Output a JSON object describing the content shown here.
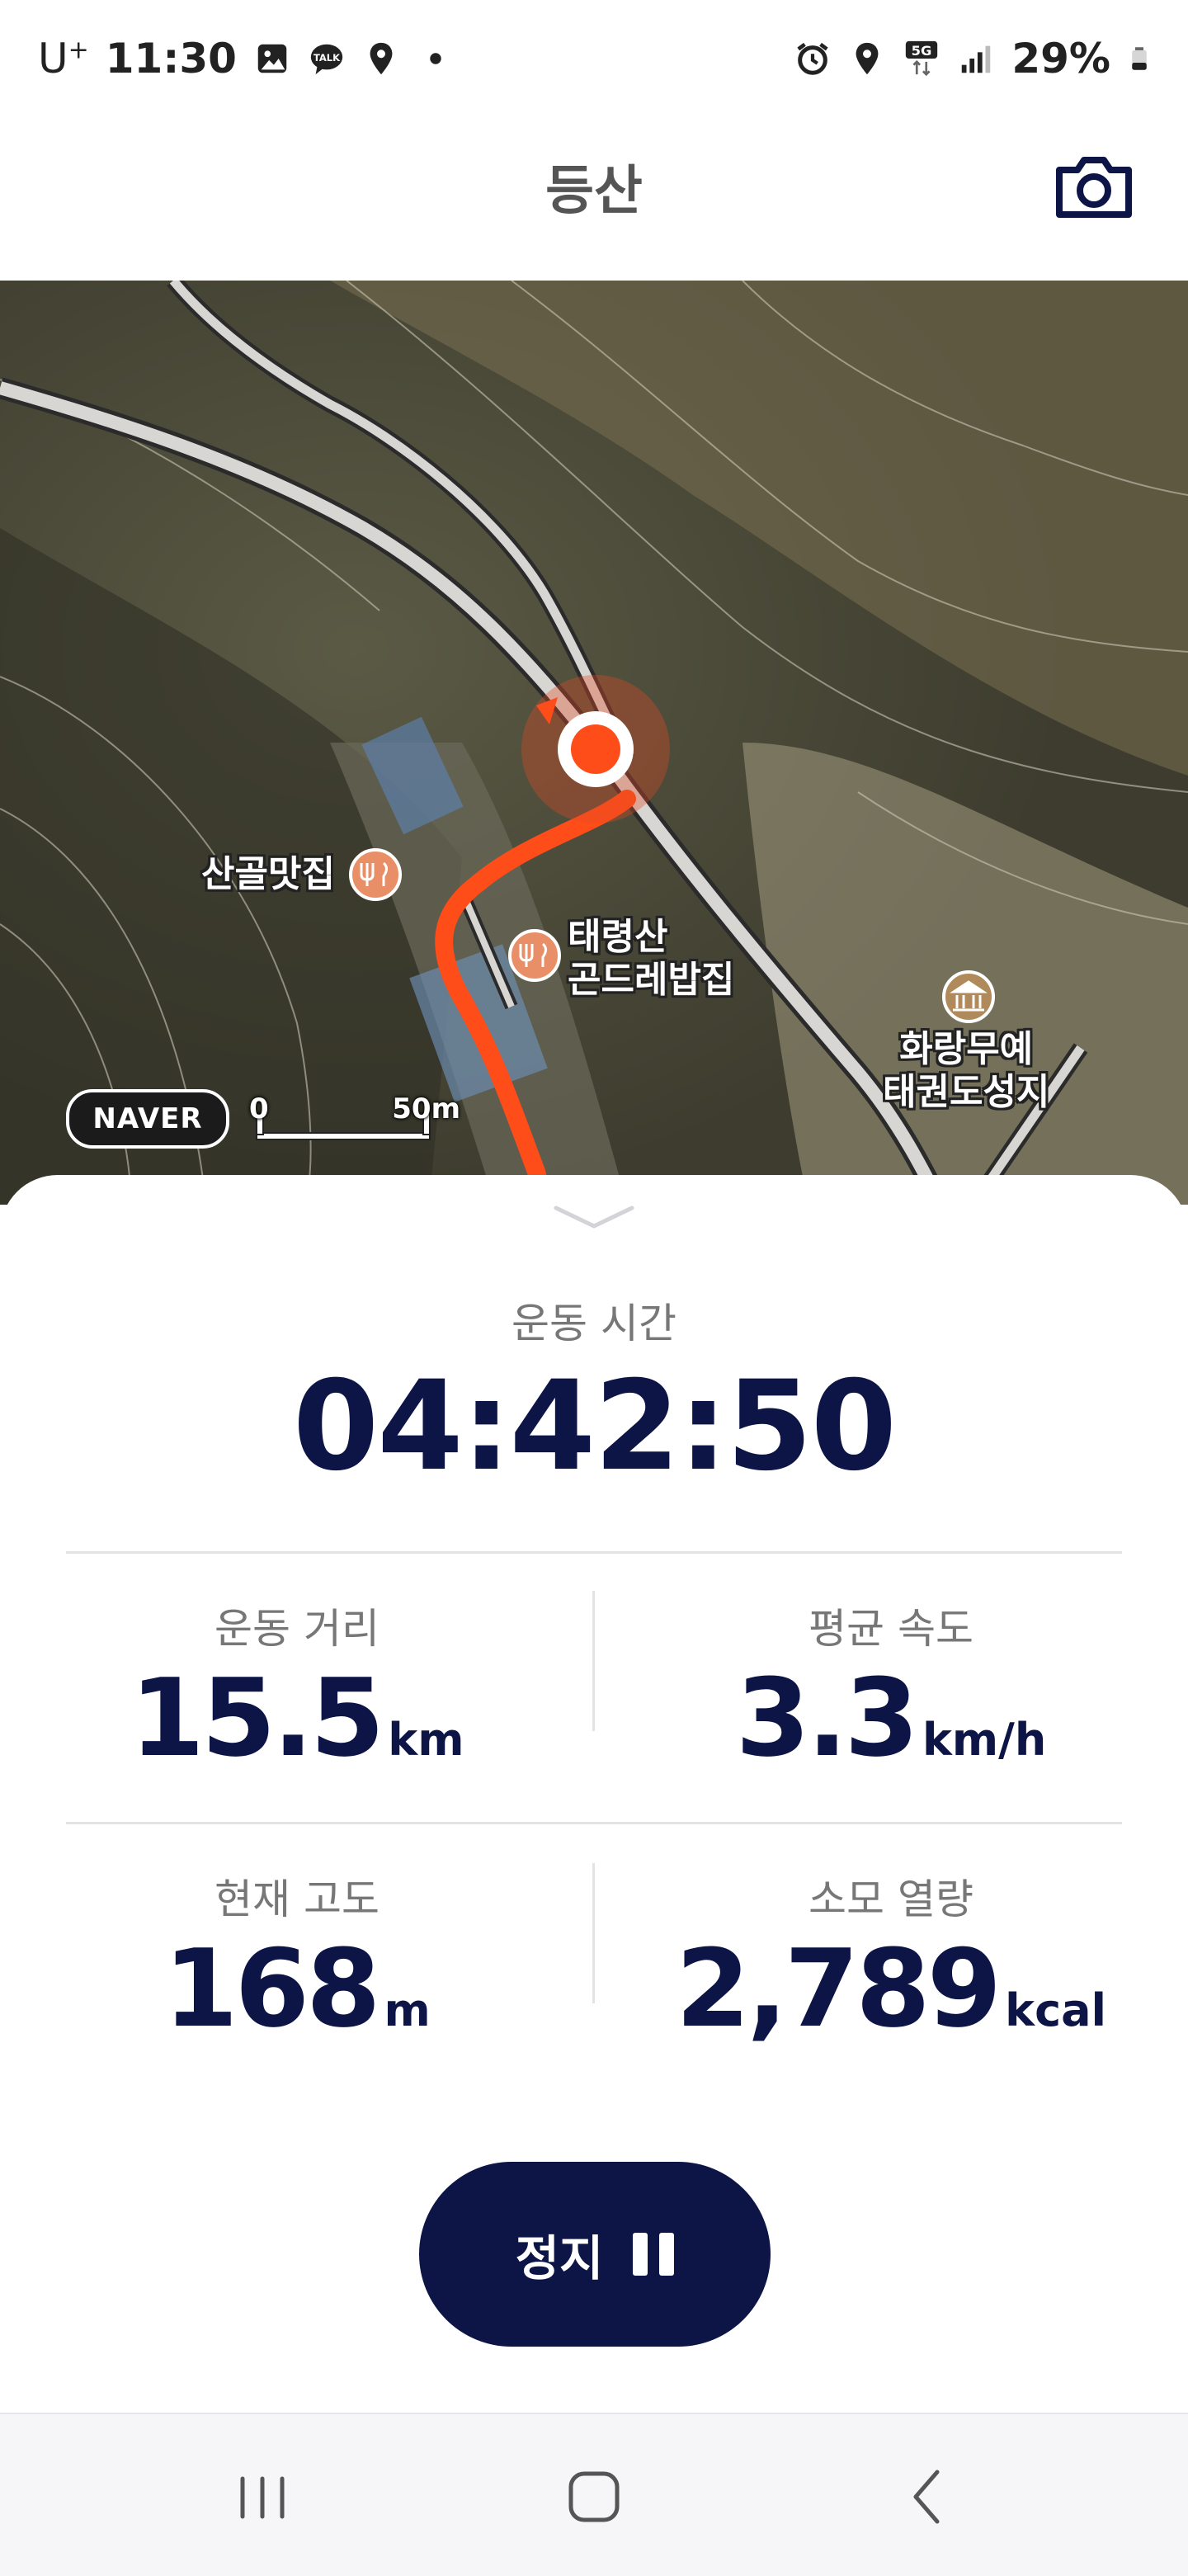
{
  "status_bar": {
    "carrier": "U",
    "carrier_sup": "+",
    "time": "11:30",
    "network": "5G",
    "battery": "29%",
    "left_icons": [
      "gallery-icon",
      "talk-icon",
      "location-icon",
      "dot-icon"
    ],
    "right_icons": [
      "alarm-icon",
      "location-icon",
      "5g-icon",
      "signal-icon",
      "battery-icon"
    ]
  },
  "header": {
    "title": "등산",
    "camera_icon": "camera-icon"
  },
  "map": {
    "pois": [
      {
        "name": "산골맛집",
        "icon": "restaurant-icon"
      },
      {
        "name_line1": "태령산",
        "name_line2": "곤드레밥집",
        "icon": "restaurant-icon"
      },
      {
        "name_line1": "화랑무예",
        "name_line2": "태권도성지",
        "icon": "landmark-icon"
      }
    ],
    "provider": "NAVER",
    "scale_start": "0",
    "scale_end": "50m",
    "colors": {
      "route": "#ff4d1a",
      "location": "#ff4d1a",
      "satellite": "#4d4a3a"
    }
  },
  "sheet": {
    "handle_icon": "chevron-down-icon",
    "time_label": "운동 시간",
    "time_value": "04:42:50",
    "stats": {
      "distance": {
        "label": "운동 거리",
        "value": "15.5",
        "unit": "km"
      },
      "avg_speed": {
        "label": "평균 속도",
        "value": "3.3",
        "unit": "km/h"
      },
      "altitude": {
        "label": "현재 고도",
        "value": "168",
        "unit": "m"
      },
      "calories": {
        "label": "소모 열량",
        "value": "2,789",
        "unit": "kcal"
      }
    },
    "stop_button": {
      "label": "정지",
      "icon": "pause-icon"
    },
    "colors": {
      "primary": "#0d1547"
    }
  },
  "nav_bar": {
    "recents_icon": "recents-icon",
    "home_icon": "home-icon",
    "back_icon": "back-icon"
  }
}
